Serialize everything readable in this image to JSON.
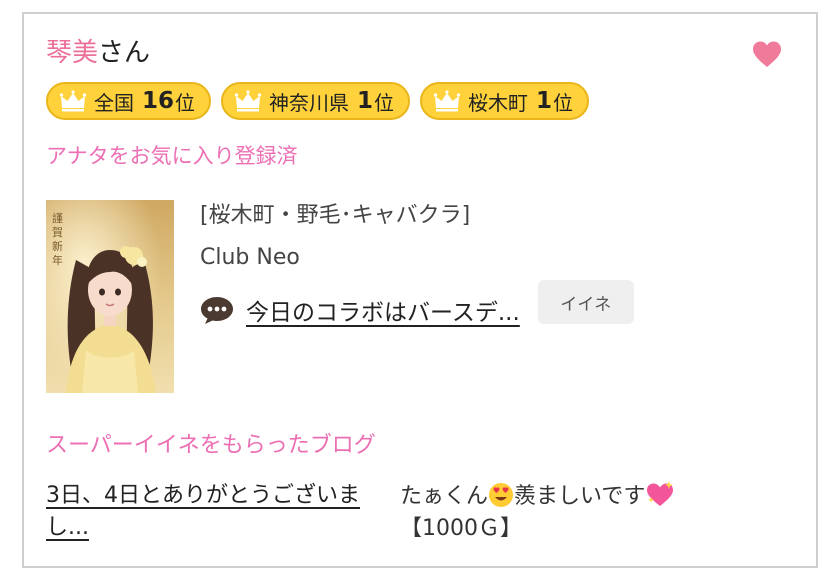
{
  "header": {
    "name": "琴美",
    "suffix": "さん"
  },
  "badges": [
    {
      "area": "全国",
      "rank": "16",
      "unit": "位"
    },
    {
      "area": "神奈川県",
      "rank": "1",
      "unit": "位"
    },
    {
      "area": "桜木町",
      "rank": "1",
      "unit": "位"
    }
  ],
  "favorite": {
    "status_text": "アナタをお気に入り登録済"
  },
  "shop": {
    "area_label": "[桜木町・野毛･キャバクラ]",
    "name": "Club Neo"
  },
  "post": {
    "title": "今日のコラボはバースデ...",
    "like_button_label": "イイネ"
  },
  "super_iine": {
    "section_title": "スーパーイイネをもらったブログ",
    "blog_title": "3日、4日とありがとうございまし...",
    "comment_part1": "たぁくん",
    "comment_part2": "羨ましいです",
    "amount": "【1000Ｇ】"
  },
  "colors": {
    "accent_pink": "#ec6fb4",
    "name_pink": "#ec6f97",
    "badge_yellow": "#ffd23c",
    "heart": "#f07a9a"
  },
  "icons": {
    "favorite": "heart-icon",
    "rank": "crown-icon",
    "post": "speech-bubble-icon"
  }
}
